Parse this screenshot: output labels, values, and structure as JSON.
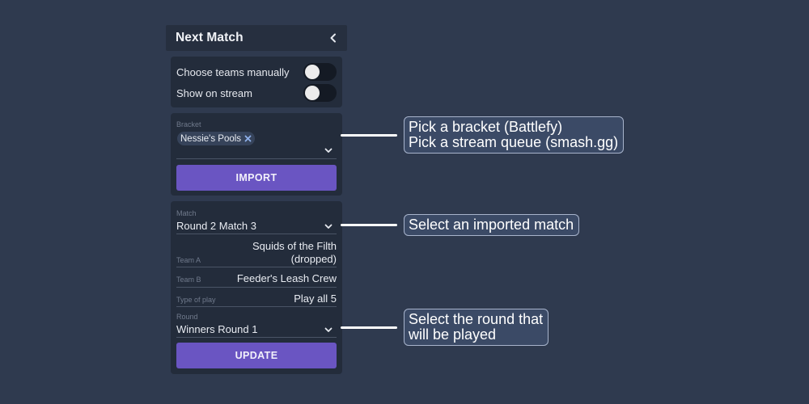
{
  "panel": {
    "title": "Next Match",
    "collapse_icon": "chevron-left-icon"
  },
  "toggles": [
    {
      "label": "Choose teams manually",
      "on": false
    },
    {
      "label": "Show on stream",
      "on": false
    }
  ],
  "bracket": {
    "label": "Bracket",
    "chip": "Nessie's Pools",
    "chip_remove_icon": "close-icon",
    "dropdown_icon": "chevron-down-icon",
    "button": "IMPORT"
  },
  "match": {
    "match_label": "Match",
    "match_value": "Round 2 Match 3",
    "team_a_label": "Team A",
    "team_a_line1": "Squids of the Filth",
    "team_a_line2": "(dropped)",
    "team_b_label": "Team B",
    "team_b_value": "Feeder's Leash Crew",
    "type_label": "Type of play",
    "type_value": "Play all 5",
    "round_label": "Round",
    "round_value": "Winners Round 1",
    "button": "UPDATE"
  },
  "callouts": {
    "bracket_line1": "Pick a bracket (Battlefy)",
    "bracket_line2": "Pick a stream queue (smash.gg)",
    "match": "Select an imported match",
    "round_line1": "Select the round that",
    "round_line2": "will be played"
  },
  "colors": {
    "background": "#2f3a4f",
    "card": "#232c3b",
    "accent_button": "#6a55c2",
    "callout_bg": "#3b4a66"
  }
}
